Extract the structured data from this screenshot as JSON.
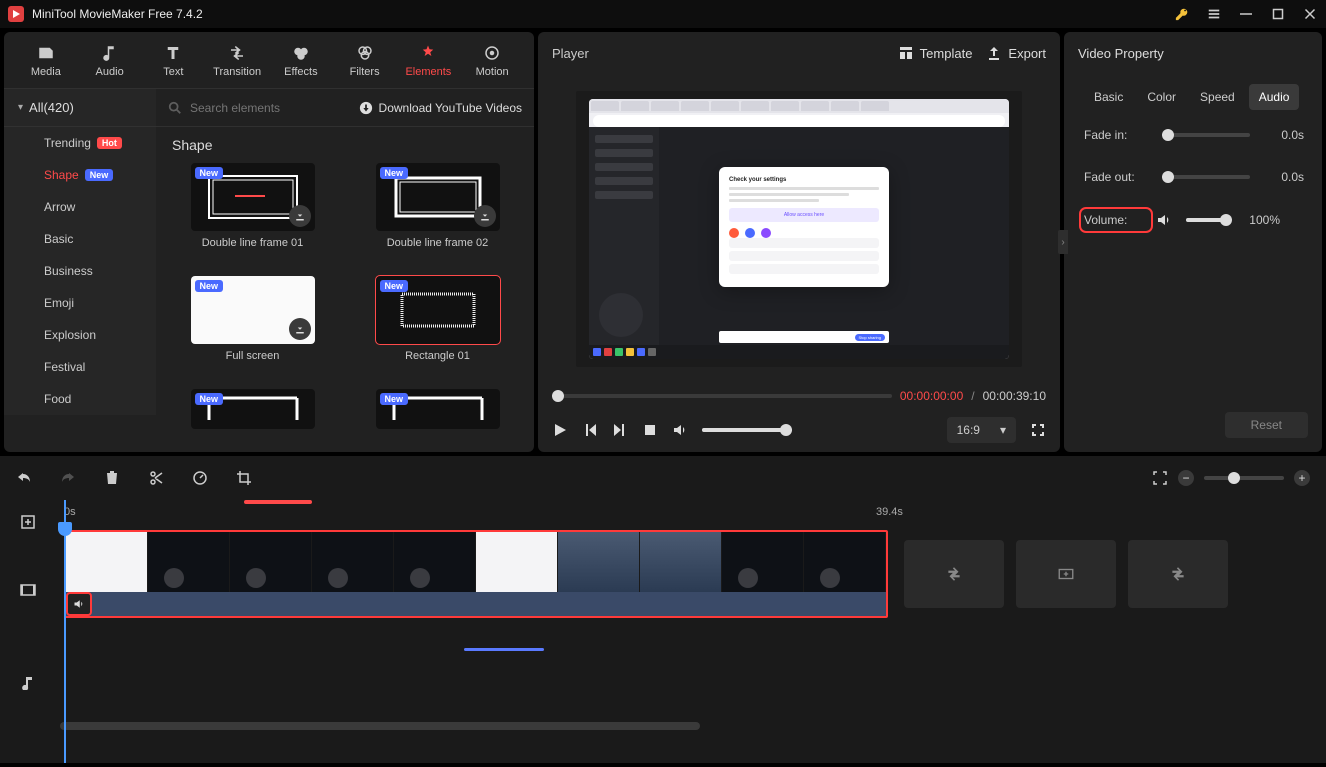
{
  "app": {
    "title": "MiniTool MovieMaker Free 7.4.2"
  },
  "toolbar": {
    "media": "Media",
    "audio": "Audio",
    "text": "Text",
    "transition": "Transition",
    "effects": "Effects",
    "filters": "Filters",
    "elements": "Elements",
    "motion": "Motion"
  },
  "categories": {
    "header": "All(420)",
    "items": [
      {
        "label": "Trending",
        "badge": "Hot"
      },
      {
        "label": "Shape",
        "badge": "New"
      },
      {
        "label": "Arrow"
      },
      {
        "label": "Basic"
      },
      {
        "label": "Business"
      },
      {
        "label": "Emoji"
      },
      {
        "label": "Explosion"
      },
      {
        "label": "Festival"
      },
      {
        "label": "Food"
      }
    ]
  },
  "elements": {
    "search_placeholder": "Search elements",
    "dl_link": "Download YouTube Videos",
    "section": "Shape",
    "items": [
      {
        "name": "Double line frame 01",
        "badge": "New"
      },
      {
        "name": "Double line frame 02",
        "badge": "New"
      },
      {
        "name": "Full screen",
        "badge": "New"
      },
      {
        "name": "Rectangle 01",
        "badge": "New"
      },
      {
        "name": "",
        "badge": "New"
      },
      {
        "name": "",
        "badge": "New"
      }
    ]
  },
  "player": {
    "title": "Player",
    "template": "Template",
    "export": "Export",
    "current": "00:00:00:00",
    "sep": "/",
    "total": "00:00:39:10",
    "ratio": "16:9",
    "mock": {
      "dialog_title": "Check your settings",
      "allow_btn": "Allow access here",
      "notif_pill": "Stop sharing"
    }
  },
  "props": {
    "title": "Video Property",
    "tabs": {
      "basic": "Basic",
      "color": "Color",
      "speed": "Speed",
      "audio": "Audio"
    },
    "fade_in_label": "Fade in:",
    "fade_in_val": "0.0s",
    "fade_out_label": "Fade out:",
    "fade_out_val": "0.0s",
    "volume_label": "Volume:",
    "volume_val": "100%",
    "reset": "Reset"
  },
  "timeline": {
    "ruler": {
      "start": "0s",
      "mid": "39.4s"
    }
  }
}
